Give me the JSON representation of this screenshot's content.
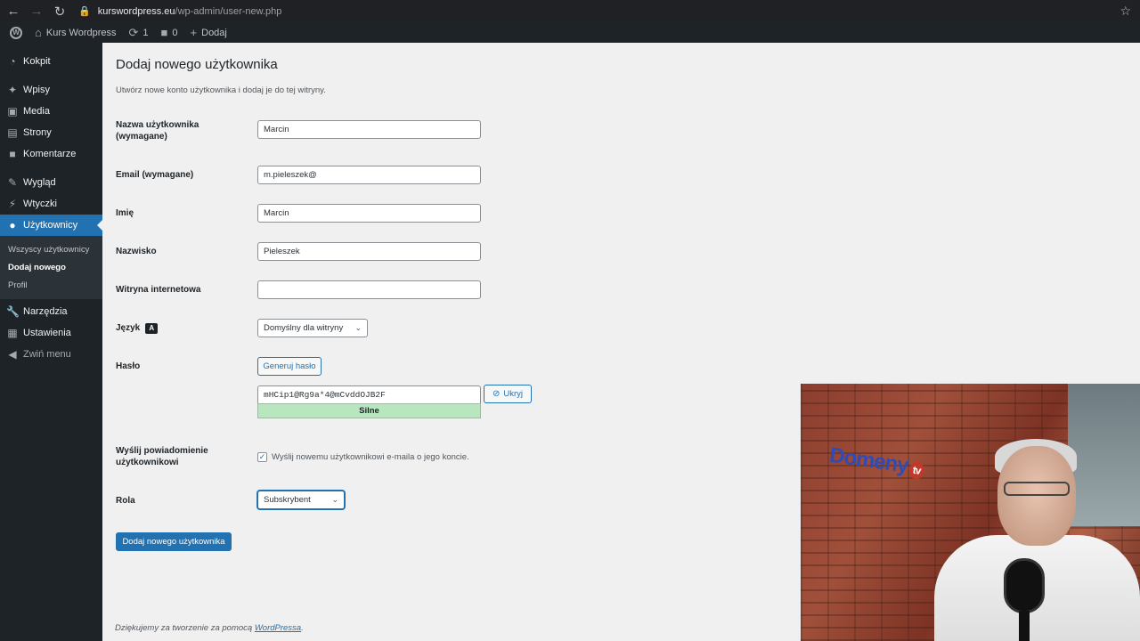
{
  "browser": {
    "url_host": "kurswordpress.eu",
    "url_path": "/wp-admin/user-new.php"
  },
  "admin_bar": {
    "site_name": "Kurs Wordpress",
    "updates_count": "1",
    "comments_count": "0",
    "new_label": "Dodaj"
  },
  "sidebar": {
    "items": [
      {
        "label": "Kokpit",
        "icon": "dashboard-icon"
      },
      {
        "label": "Wpisy",
        "icon": "pin-icon"
      },
      {
        "label": "Media",
        "icon": "media-icon"
      },
      {
        "label": "Strony",
        "icon": "page-icon"
      },
      {
        "label": "Komentarze",
        "icon": "comment-icon"
      },
      {
        "label": "Wygląd",
        "icon": "brush-icon"
      },
      {
        "label": "Wtyczki",
        "icon": "plugin-icon"
      },
      {
        "label": "Użytkownicy",
        "icon": "users-icon"
      },
      {
        "label": "Narzędzia",
        "icon": "wrench-icon"
      },
      {
        "label": "Ustawienia",
        "icon": "settings-icon"
      },
      {
        "label": "Zwiń menu",
        "icon": "collapse-icon"
      }
    ],
    "submenu": [
      "Wszyscy użytkownicy",
      "Dodaj nowego",
      "Profil"
    ]
  },
  "page": {
    "title": "Dodaj nowego użytkownika",
    "description": "Utwórz nowe konto użytkownika i dodaj je do tej witryny."
  },
  "form": {
    "username_label": "Nazwa użytkownika (wymagane)",
    "username_value": "Marcin",
    "email_label": "Email (wymagane)",
    "email_value": "m.pieleszek@",
    "first_name_label": "Imię",
    "first_name_value": "Marcin",
    "last_name_label": "Nazwisko",
    "last_name_value": "Pieleszek",
    "website_label": "Witryna internetowa",
    "website_value": "",
    "language_label": "Język",
    "language_value": "Domyślny dla witryny",
    "password_label": "Hasło",
    "generate_password_label": "Generuj hasło",
    "password_value": "mHCip1@Rg9a*4@mCvddOJB2F",
    "password_strength": "Silne",
    "hide_password_label": "Ukryj",
    "notify_label": "Wyślij powiadomienie użytkownikowi",
    "notify_checkbox_label": "Wyślij nowemu użytkownikowi e-maila o jego koncie.",
    "notify_checked": true,
    "role_label": "Rola",
    "role_value": "Subskrybent",
    "submit_label": "Dodaj nowego użytkownika"
  },
  "footer": {
    "text": "Dziękujemy za tworzenie za pomocą",
    "link": "WordPressa",
    "end": "."
  },
  "webcam": {
    "logo_text": "Domeny",
    "logo_badge": "tv"
  }
}
